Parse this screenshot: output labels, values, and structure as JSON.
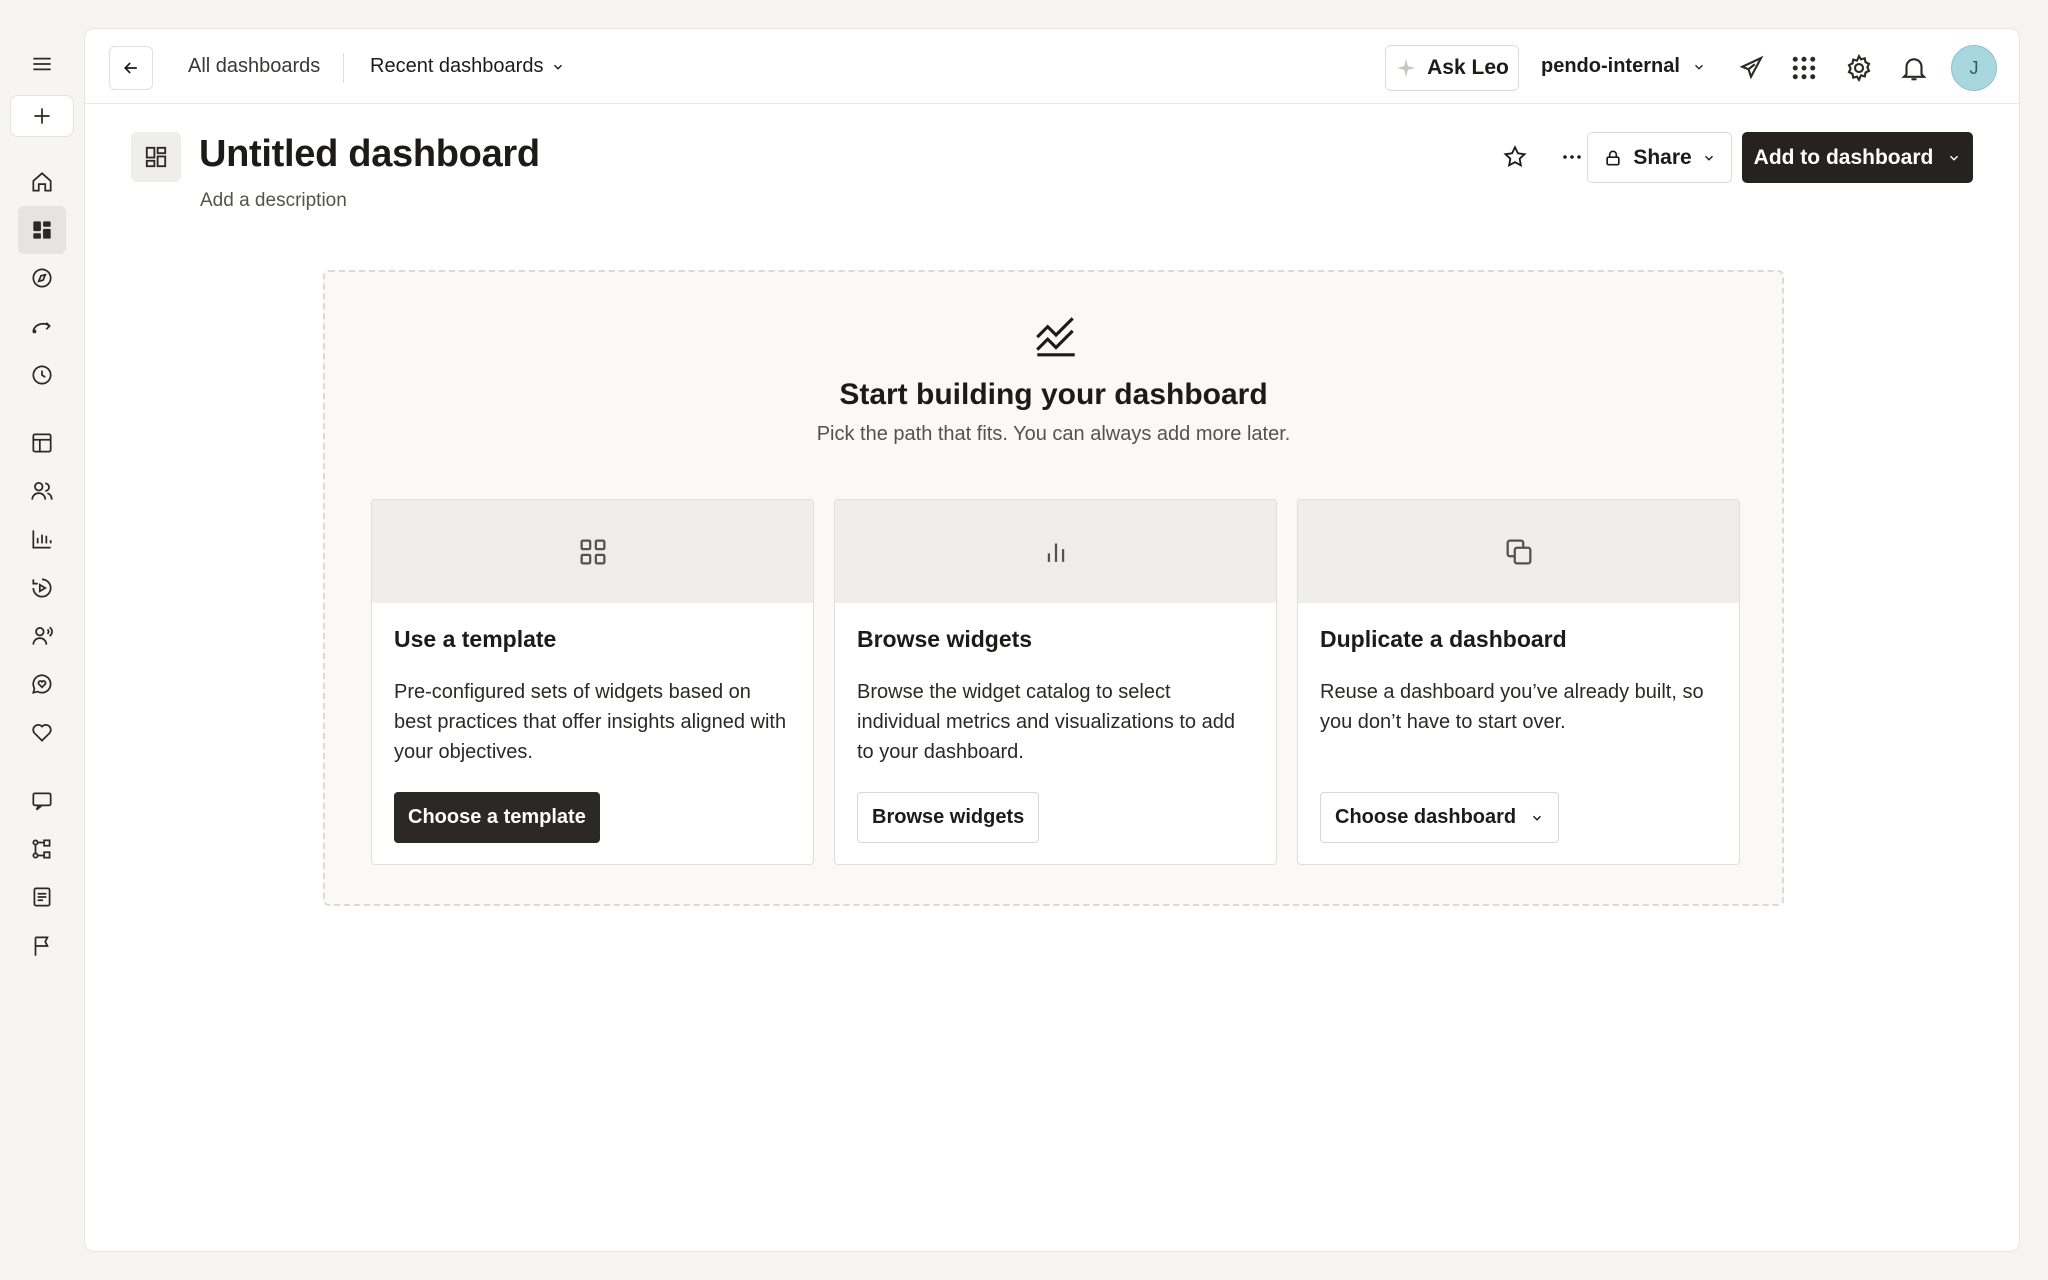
{
  "nav": {
    "breadcrumb_all": "All dashboards",
    "recent_label": "Recent dashboards",
    "ask_leo_label": "Ask Leo",
    "org_name": "pendo-internal",
    "avatar_initial": "J"
  },
  "rail": {
    "icons": [
      "menu-icon",
      "plus-icon",
      "home-icon",
      "dashboards-icon",
      "compass-icon",
      "path-icon",
      "clock-icon",
      "layout-icon",
      "users-icon",
      "bar-chart-icon",
      "replay-icon",
      "account-icon",
      "chat-heart-icon",
      "heart-icon",
      "comment-icon",
      "workflow-icon",
      "notes-icon",
      "flag-icon"
    ],
    "active": "dashboards-icon"
  },
  "header": {
    "title": "Untitled dashboard",
    "description_placeholder": "Add a description",
    "share_label": "Share",
    "add_label": "Add to dashboard"
  },
  "empty_state": {
    "title": "Start building your dashboard",
    "subtitle": "Pick the path that fits. You can always add more later.",
    "cards": [
      {
        "title": "Use a template",
        "body": "Pre-configured sets of widgets based on best practices that offer insights aligned with your objectives.",
        "button": "Choose a template"
      },
      {
        "title": "Browse widgets",
        "body": "Browse the widget catalog to select individual metrics and visualizations to add to your dashboard.",
        "button": "Browse widgets"
      },
      {
        "title": "Duplicate a dashboard",
        "body": "Reuse a dashboard you’ve already built, so you don’t have to start over.",
        "button": "Choose dashboard"
      }
    ]
  },
  "colors": {
    "primary_button": "#25221f",
    "avatar_bg": "#a9d7e0",
    "page_bg": "#f6f5f3"
  }
}
